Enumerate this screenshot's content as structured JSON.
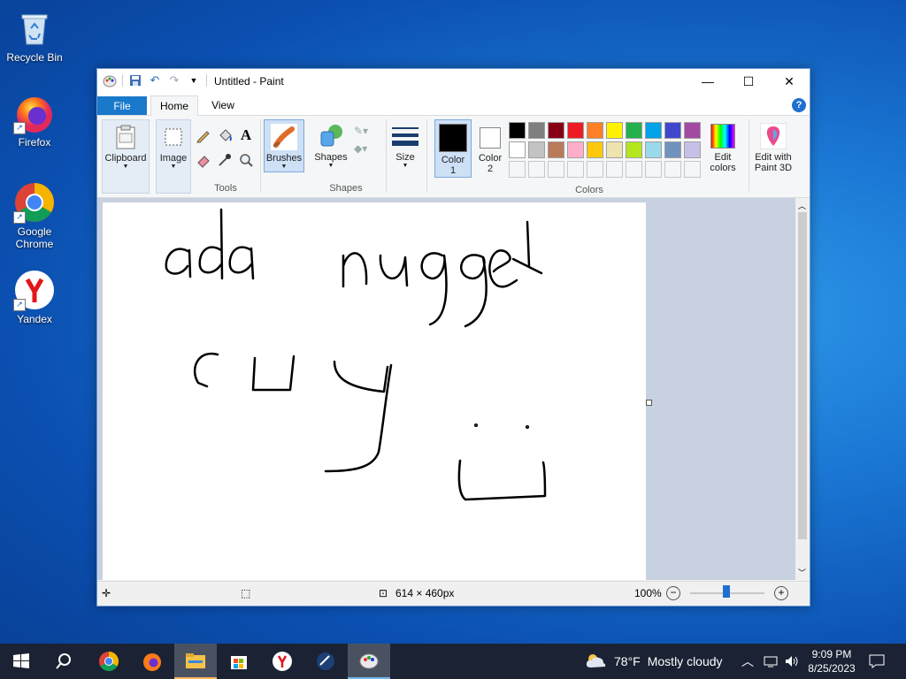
{
  "desktop": {
    "icons": [
      {
        "label": "Recycle Bin",
        "icon": "recycle-bin-icon"
      },
      {
        "label": "Firefox",
        "icon": "firefox-icon"
      },
      {
        "label": "Google Chrome",
        "icon": "chrome-icon"
      },
      {
        "label": "Yandex",
        "icon": "yandex-icon"
      }
    ]
  },
  "window": {
    "title": "Untitled - Paint",
    "tabs": {
      "file": "File",
      "home": "Home",
      "view": "View"
    },
    "ribbon": {
      "clipboard": "Clipboard",
      "image": "Image",
      "tools": "Tools",
      "brushes": "Brushes",
      "shapes": "Shapes",
      "shapes_group": "Shapes",
      "size": "Size",
      "color1": "Color 1",
      "color2": "Color 2",
      "colors_group": "Colors",
      "edit_colors": "Edit colors",
      "edit_paint3d": "Edit with Paint 3D"
    },
    "palette_row1": [
      "#000000",
      "#7f7f7f",
      "#880015",
      "#ed1c24",
      "#ff7f27",
      "#fff200",
      "#22b14c",
      "#00a2e8",
      "#3f48cc",
      "#a349a4"
    ],
    "palette_row2": [
      "#ffffff",
      "#c3c3c3",
      "#b97a57",
      "#ffaec9",
      "#ffc90e",
      "#efe4b0",
      "#b5e61d",
      "#99d9ea",
      "#7092be",
      "#c8bfe7"
    ],
    "status": {
      "dimensions": "614 × 460px",
      "zoom": "100%"
    }
  },
  "taskbar": {
    "weather_temp": "78°F",
    "weather_desc": "Mostly cloudy",
    "time": "9:09 PM",
    "date": "8/25/2023"
  }
}
